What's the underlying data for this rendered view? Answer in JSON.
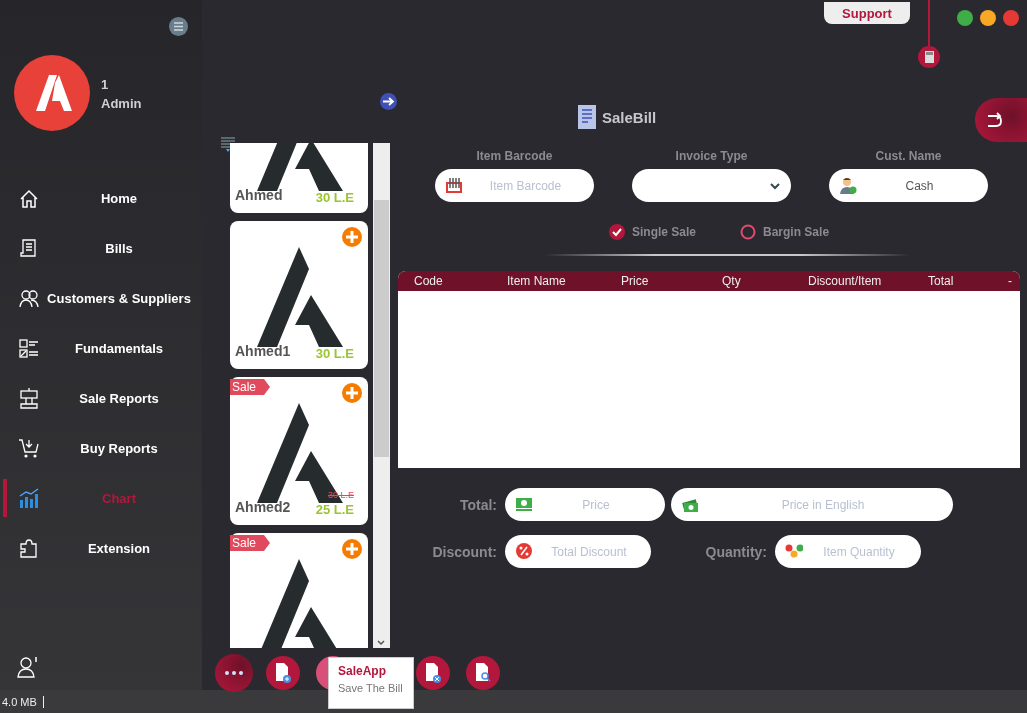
{
  "sidebar": {
    "user_id": "1",
    "user_role": "Admin",
    "items": [
      {
        "label": "Home",
        "selected": false
      },
      {
        "label": "Bills",
        "selected": false
      },
      {
        "label": "Customers & Suppliers",
        "selected": false
      },
      {
        "label": "Fundamentals",
        "selected": false
      },
      {
        "label": "Sale Reports",
        "selected": false
      },
      {
        "label": "Buy Reports",
        "selected": false
      },
      {
        "label": "Chart",
        "selected": true
      },
      {
        "label": "Extension",
        "selected": false
      }
    ]
  },
  "top_bar": {
    "support_button": "Support"
  },
  "products": [
    {
      "name": "Ahmed",
      "price": "30 L.E"
    },
    {
      "name": "Ahmed1",
      "price": "30 L.E"
    },
    {
      "name": "Ahmed2",
      "old_price": "30 L.E",
      "price": "25 L.E",
      "badge": "Sale"
    },
    {
      "badge": "Sale"
    }
  ],
  "form": {
    "title": "SaleBill",
    "fields": [
      {
        "label": "Item Barcode",
        "kind": "text",
        "placeholder": "Item Barcode"
      },
      {
        "label": "Invoice Type",
        "kind": "dropdown"
      },
      {
        "label": "Cust. Name",
        "kind": "text",
        "value": "Cash"
      }
    ],
    "sale_modes": [
      {
        "label": "Single Sale",
        "selected": true
      },
      {
        "label": "Bargin Sale",
        "selected": false
      }
    ]
  },
  "table": {
    "columns": [
      "Code",
      "Item Name",
      "Price",
      "Qty",
      "Discount/Item",
      "Total",
      "-"
    ]
  },
  "totals": [
    {
      "label": "Total:",
      "fields": [
        {
          "placeholder": "Price"
        },
        {
          "placeholder": "Price in English"
        }
      ]
    },
    {
      "label": "Discount:",
      "fields": [
        {
          "placeholder": "Total Discount"
        }
      ]
    },
    {
      "label": "Quantity:",
      "fields": [
        {
          "placeholder": "Item Quantity"
        }
      ]
    }
  ],
  "tooltip": {
    "title": "SaleApp",
    "text": "Save The Bill"
  },
  "status_bar": {
    "memory": "4.0 MB"
  }
}
